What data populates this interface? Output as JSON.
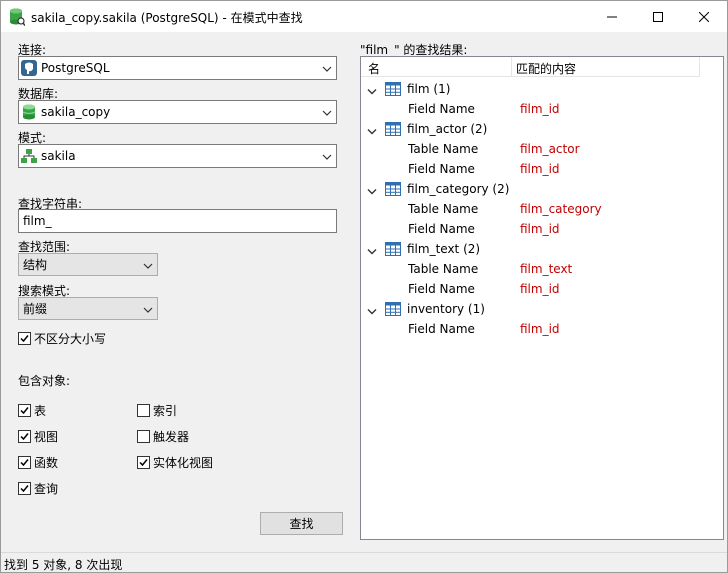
{
  "window": {
    "title": "sakila_copy.sakila (PostgreSQL) - 在模式中查找"
  },
  "form": {
    "connection_label": "连接:",
    "connection_value": "PostgreSQL",
    "database_label": "数据库:",
    "database_value": "sakila_copy",
    "schema_label": "模式:",
    "schema_value": "sakila",
    "search_string_label": "查找字符串:",
    "search_string_value": "film_",
    "search_scope_label": "查找范围:",
    "search_scope_value": "结构",
    "search_mode_label": "搜索模式:",
    "search_mode_value": "前缀",
    "case_insensitive_label": "不区分大小写",
    "case_insensitive_checked": true,
    "include_objects_label": "包含对象:",
    "objects": [
      {
        "label": "表",
        "checked": true
      },
      {
        "label": "索引",
        "checked": false
      },
      {
        "label": "视图",
        "checked": true
      },
      {
        "label": "触发器",
        "checked": false
      },
      {
        "label": "函数",
        "checked": true
      },
      {
        "label": "实体化视图",
        "checked": true
      },
      {
        "label": "查询",
        "checked": true
      }
    ],
    "find_button": "查找"
  },
  "results": {
    "label": "\"film_\" 的查找结果:",
    "col_name": "名",
    "col_match": "匹配的内容",
    "groups": [
      {
        "name": "film (1)",
        "items": [
          {
            "kind": "Field Name",
            "match": "film_id"
          }
        ]
      },
      {
        "name": "film_actor (2)",
        "items": [
          {
            "kind": "Table Name",
            "match": "film_actor"
          },
          {
            "kind": "Field Name",
            "match": "film_id"
          }
        ]
      },
      {
        "name": "film_category (2)",
        "items": [
          {
            "kind": "Table Name",
            "match": "film_category"
          },
          {
            "kind": "Field Name",
            "match": "film_id"
          }
        ]
      },
      {
        "name": "film_text (2)",
        "items": [
          {
            "kind": "Table Name",
            "match": "film_text"
          },
          {
            "kind": "Field Name",
            "match": "film_id"
          }
        ]
      },
      {
        "name": "inventory (1)",
        "items": [
          {
            "kind": "Field Name",
            "match": "film_id"
          }
        ]
      }
    ]
  },
  "status": {
    "text": "找到 5 对象, 8 次出现"
  },
  "colors": {
    "match_text": "#c00000",
    "table_icon": "#2f6fb2"
  },
  "icons": {
    "app": "database-search-icon",
    "connection": "postgresql-elephant-icon",
    "database": "database-icon",
    "schema": "schema-icon",
    "table": "table-icon",
    "expand": "chevron-down-icon"
  }
}
